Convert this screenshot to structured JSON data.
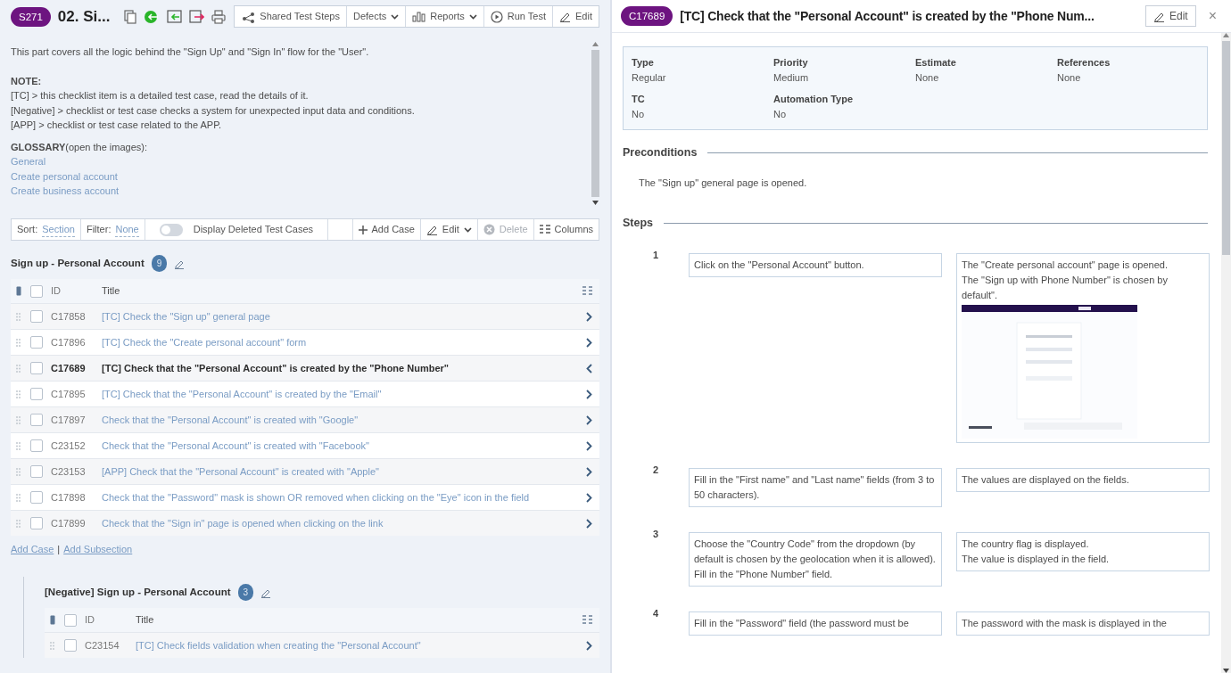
{
  "suite_header": {
    "badge": "S271",
    "title": "02. Si..."
  },
  "header_buttons": [
    {
      "label": "Shared Test Steps",
      "dropdown": false
    },
    {
      "label": "Defects",
      "dropdown": true
    },
    {
      "label": "Reports",
      "dropdown": true
    },
    {
      "label": "Run Test",
      "dropdown": false
    },
    {
      "label": "Edit",
      "dropdown": false
    }
  ],
  "description": {
    "intro": "This part covers all the logic behind the \"Sign Up\" and \"Sign In\" flow for the \"User\".",
    "note_title": "NOTE:",
    "note_lines": [
      "[TC] > this checklist item is a detailed test case, read the details of it.",
      "[Negative] > checklist or test case checks a system for unexpected input data and conditions.",
      "[APP] > checklist or test case related to the APP."
    ],
    "glossary": "**GLOSSARY**(open the images):",
    "glossary_links": [
      "General",
      "Create personal account",
      "Create business account"
    ]
  },
  "list_toolbar": {
    "sort_label": "Sort:",
    "sort_value": "Section",
    "filter_label": "Filter:",
    "filter_value": "None",
    "toggle": {
      "label": "Display Deleted Test Cases",
      "on": false
    },
    "actions": [
      {
        "label": "Add Case",
        "dropdown": false,
        "disabled": false
      },
      {
        "label": "Edit",
        "dropdown": true,
        "disabled": false
      },
      {
        "label": "Delete",
        "dropdown": false,
        "disabled": true
      },
      {
        "label": "Columns",
        "dropdown": false,
        "disabled": false
      }
    ]
  },
  "sections": [
    {
      "title": "Sign up - Personal Account",
      "count": "9",
      "columns": [
        "ID",
        "Title"
      ],
      "all_checked": false,
      "rows": [
        {
          "id": "C17858",
          "title": "[TC] Check the \"Sign up\" general page",
          "checked": false,
          "selected": false
        },
        {
          "id": "C17896",
          "title": "[TC] Check the \"Create personal account\" form",
          "checked": false,
          "selected": false
        },
        {
          "id": "C17689",
          "title": "[TC] Check that the \"Personal Account\" is created by the \"Phone Number\"",
          "checked": false,
          "selected": true
        },
        {
          "id": "C17895",
          "title": "[TC] Check that the \"Personal Account\" is created by the \"Email\"",
          "checked": false,
          "selected": false
        },
        {
          "id": "C17897",
          "title": "Check that the \"Personal Account\" is created with \"Google\"",
          "checked": false,
          "selected": false
        },
        {
          "id": "C23152",
          "title": "Check that the \"Personal Account\" is created with \"Facebook\"",
          "checked": false,
          "selected": false
        },
        {
          "id": "C23153",
          "title": "[APP] Check that the \"Personal Account\" is created with \"Apple\"",
          "checked": false,
          "selected": false
        },
        {
          "id": "C17898",
          "title": "Check that the \"Password\" mask is shown OR removed when clicking on the \"Eye\" icon in the field",
          "checked": false,
          "selected": false
        },
        {
          "id": "C17899",
          "title": "Check that the \"Sign in\" page is opened when clicking on the link",
          "checked": false,
          "selected": false
        }
      ],
      "links": [
        "Add Case",
        "Add Subsection"
      ],
      "link_separator": "|",
      "subsections": [
        {
          "title": "[Negative] Sign up - Personal Account",
          "count": "3",
          "columns": [
            "ID",
            "Title"
          ],
          "all_checked": false,
          "rows": [
            {
              "id": "C23154",
              "title": "[TC] Check fields validation when creating the \"Personal Account\"",
              "checked": false,
              "selected": false
            }
          ]
        }
      ]
    }
  ],
  "case": {
    "badge": "C17689",
    "title": "[TC] Check that the \"Personal Account\" is created by the \"Phone Num...",
    "edit": "Edit",
    "close": "×",
    "fields": [
      {
        "label": "Type",
        "value": "Regular"
      },
      {
        "label": "Priority",
        "value": "Medium"
      },
      {
        "label": "Estimate",
        "value": "None"
      },
      {
        "label": "References",
        "value": "None"
      },
      {
        "label": "TC",
        "value": "No"
      },
      {
        "label": "Automation Type",
        "value": "No"
      }
    ],
    "preconditions": {
      "heading": "Preconditions",
      "text": "The \"Sign up\" general page is opened."
    },
    "steps": {
      "heading": "Steps",
      "items": [
        {
          "number": "1",
          "action": [
            "Click on the \"Personal Account\" button."
          ],
          "expected": [
            "The \"Create personal account\" page is opened.",
            "The \"Sign up with Phone Number\" is chosen by default\"."
          ],
          "attachment": {
            "kind": "picture"
          }
        },
        {
          "number": "2",
          "action": [
            "Fill in the \"First name\" and \"Last name\" fields (from 3 to 50 characters)."
          ],
          "expected": [
            "The values are displayed on the fields."
          ]
        },
        {
          "number": "3",
          "action": [
            "Choose the \"Country Code\" from the dropdown (by default is chosen by the geolocation when it is allowed).",
            "Fill in the \"Phone Number\" field."
          ],
          "expected": [
            "The country flag is displayed.",
            "The value is displayed in the field."
          ]
        },
        {
          "number": "4",
          "action": [
            "Fill in the \"Password\" field (the password must be"
          ],
          "expected": [
            "The password with the mask is displayed in the"
          ]
        }
      ]
    }
  }
}
